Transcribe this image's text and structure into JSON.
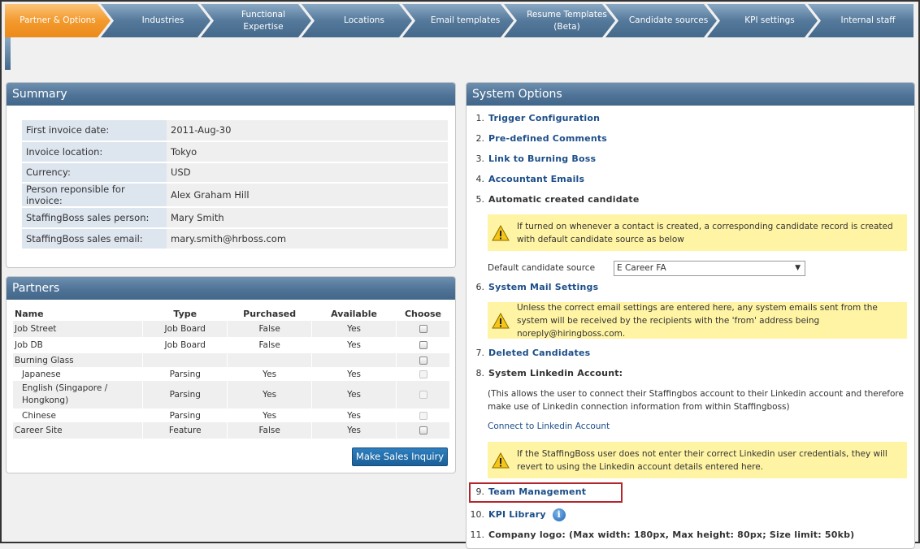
{
  "tabs": [
    {
      "label": "Partner & Options",
      "active": true
    },
    {
      "label": "Industries"
    },
    {
      "label": "Functional Expertise"
    },
    {
      "label": "Locations"
    },
    {
      "label": "Email templates"
    },
    {
      "label": "Resume Templates (Beta)"
    },
    {
      "label": "Candidate sources"
    },
    {
      "label": "KPI settings"
    },
    {
      "label": "Internal staff"
    }
  ],
  "summary": {
    "title": "Summary",
    "rows": [
      {
        "label": "First invoice date:",
        "value": "2011-Aug-30"
      },
      {
        "label": "Invoice location:",
        "value": "Tokyo"
      },
      {
        "label": "Currency:",
        "value": "USD"
      },
      {
        "label": "Person reponsible for invoice:",
        "value": "Alex Graham Hill"
      },
      {
        "label": "StaffingBoss sales person:",
        "value": "Mary Smith"
      },
      {
        "label": "StaffingBoss sales email:",
        "value": "mary.smith@hrboss.com"
      }
    ]
  },
  "partners": {
    "title": "Partners",
    "headers": {
      "name": "Name",
      "type": "Type",
      "purchased": "Purchased",
      "available": "Available",
      "choose": "Choose"
    },
    "rows": [
      {
        "name": "Job Street",
        "type": "Job Board",
        "purchased": "False",
        "available": "Yes"
      },
      {
        "name": "Job DB",
        "type": "Job Board",
        "purchased": "False",
        "available": "Yes"
      },
      {
        "name": "Burning Glass",
        "type": "",
        "purchased": "",
        "available": ""
      },
      {
        "name": "Japanese",
        "type": "Parsing",
        "purchased": "Yes",
        "available": "Yes"
      },
      {
        "name": "English (Singapore / Hongkong)",
        "type": "Parsing",
        "purchased": "Yes",
        "available": "Yes"
      },
      {
        "name": "Chinese",
        "type": "Parsing",
        "purchased": "Yes",
        "available": "Yes"
      },
      {
        "name": "Career Site",
        "type": "Feature",
        "purchased": "False",
        "available": "Yes"
      }
    ],
    "button_label": "Make Sales Inquiry"
  },
  "system_options": {
    "title": "System Options",
    "items": [
      {
        "num": "1.",
        "label": "Trigger Configuration"
      },
      {
        "num": "2.",
        "label": "Pre-defined Comments"
      },
      {
        "num": "3.",
        "label": "Link to Burning Boss"
      },
      {
        "num": "4.",
        "label": "Accountant Emails"
      },
      {
        "num": "5.",
        "label": "Automatic created candidate"
      },
      {
        "num": "6.",
        "label": "System Mail Settings"
      },
      {
        "num": "7.",
        "label": "Deleted Candidates"
      },
      {
        "num": "8.",
        "label": "System Linkedin Account:"
      },
      {
        "num": "9.",
        "label": "Team Management"
      },
      {
        "num": "10.",
        "label": "KPI Library"
      },
      {
        "num": "11.",
        "label": "Company logo: (Max width: 180px, Max height: 80px; Size limit: 50kb)"
      }
    ],
    "warn_auto_candidate": "If turned on whenever a contact is created, a corresponding candidate record is created with default candidate source as below",
    "default_source_label": "Default candidate source",
    "default_source_value": "E Career  FA",
    "warn_mail": "Unless the correct email settings are entered here, any system emails sent from the system will be received by the recipients with the 'from' address being noreply@hiringboss.com.",
    "linkedin_note": "(This allows the user to connect their Staffingbos account to their Linkedin account and therefore make use of Linkedin connection information from within Staffingboss)",
    "linkedin_link": "Connect to Linkedin Account",
    "warn_linkedin": "If the StaffingBoss user does not enter their correct Linkedin user credentials, they will revert to using the Linkedin account details entered here."
  },
  "colors": {
    "active_tab": "#f39a2e",
    "tab": "#55799b",
    "panel_header": "#4f7396",
    "link": "#1c4e88",
    "warning_bg": "#fff4a3",
    "highlight": "#b3262b"
  }
}
